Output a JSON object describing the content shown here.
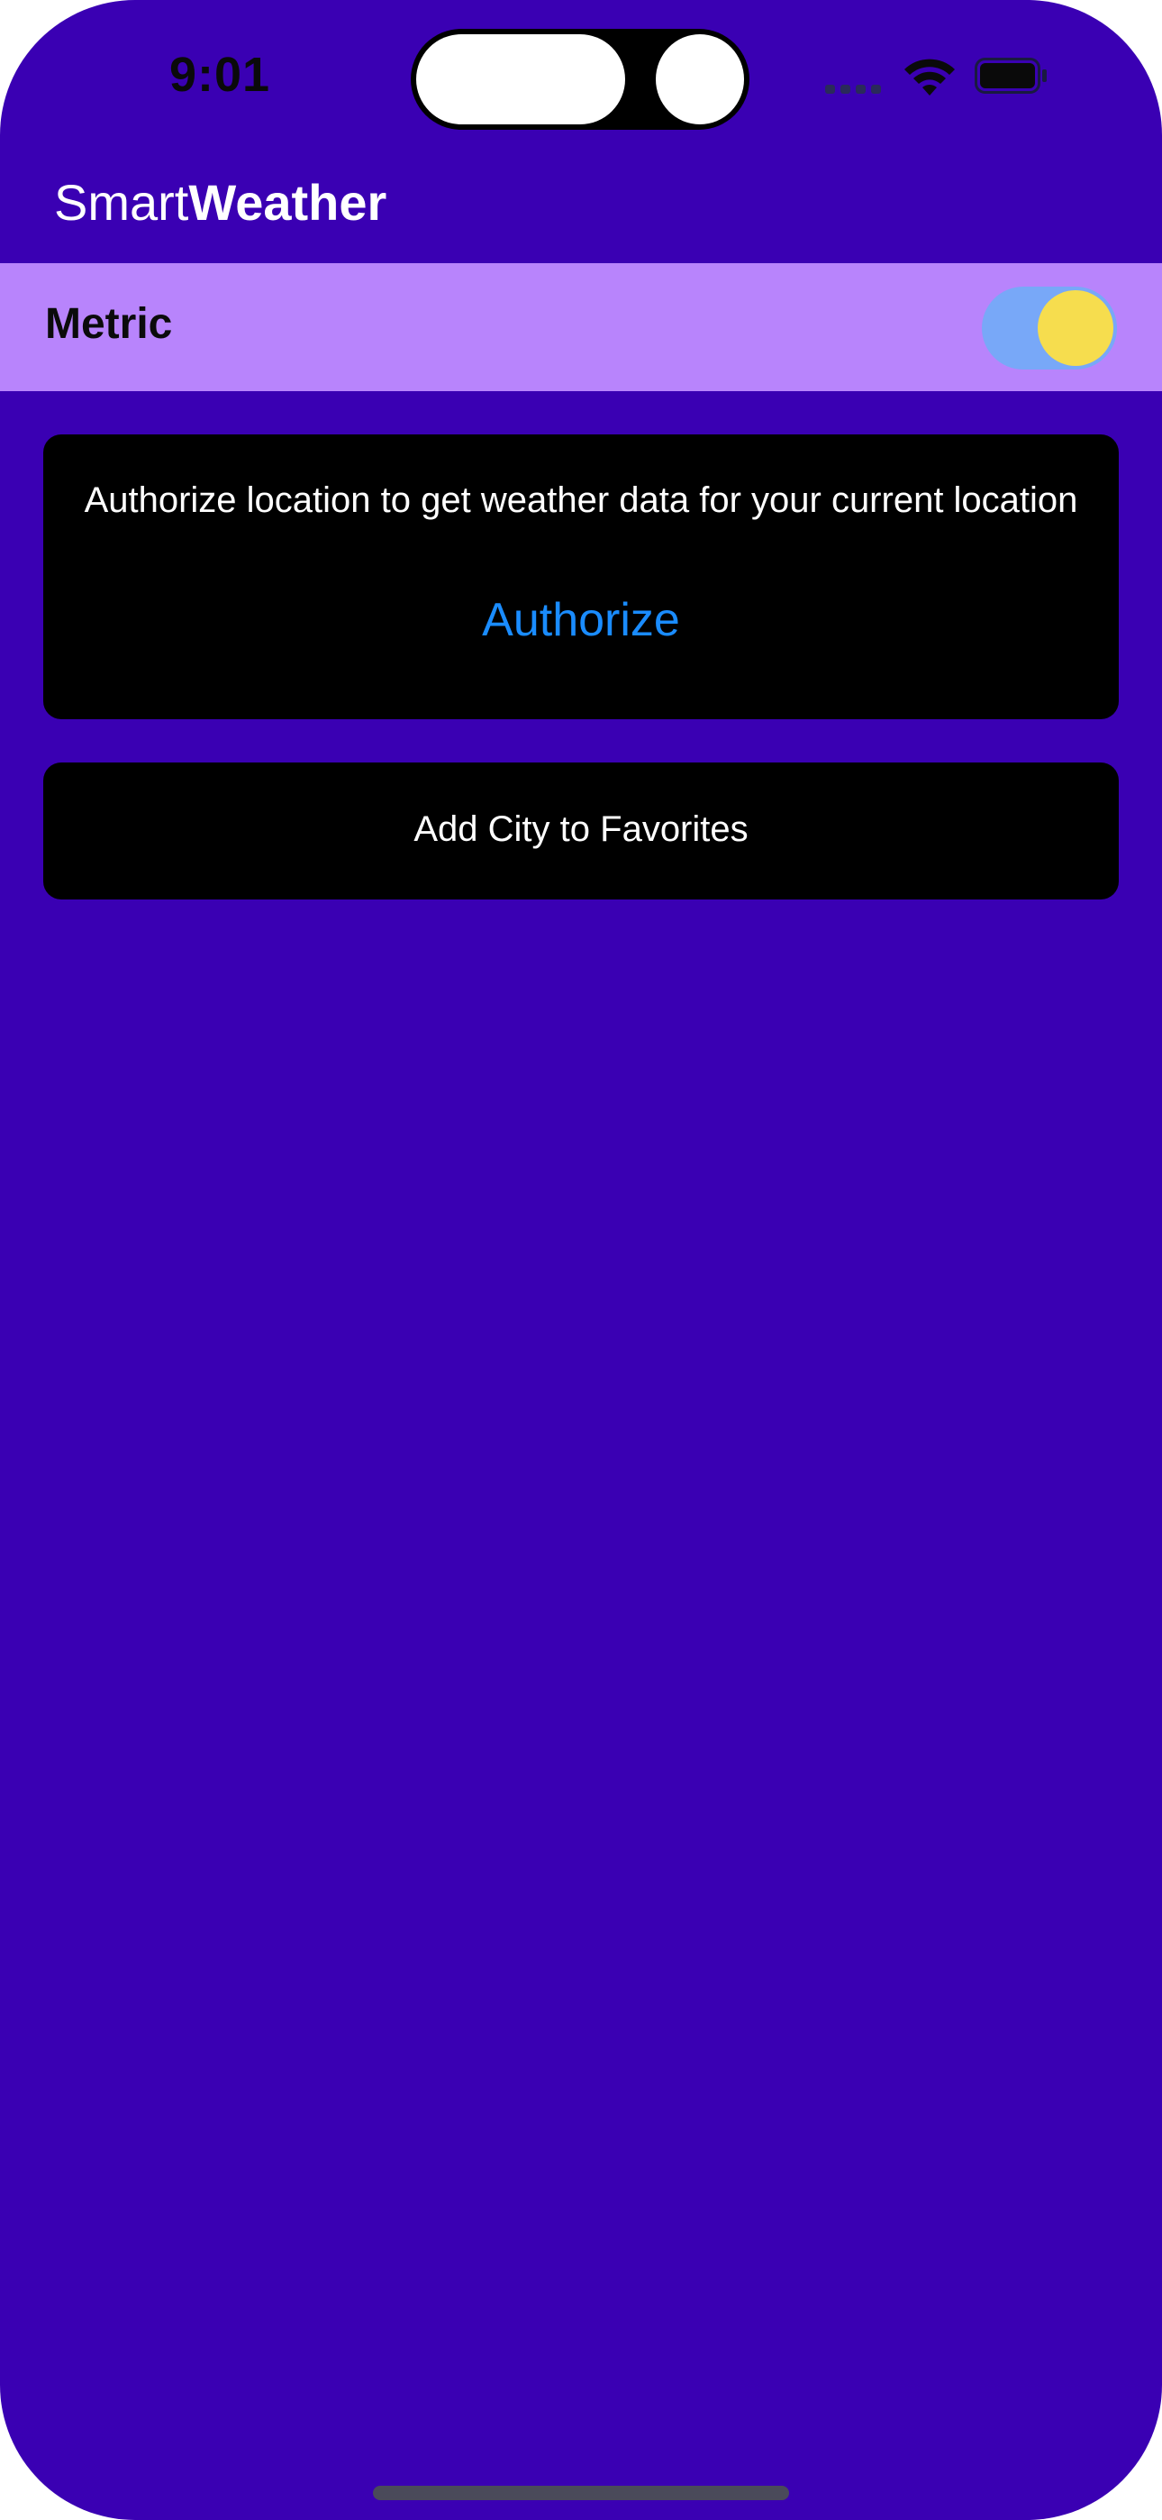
{
  "status_bar": {
    "time": "9:01",
    "icons": [
      "cellular-signal-icon",
      "wifi-icon",
      "battery-icon"
    ]
  },
  "header": {
    "title_light": "Smart",
    "title_bold": "Weather"
  },
  "units": {
    "label": "Metric",
    "toggle_on": true
  },
  "location_card": {
    "message": "Authorize location to get weather data for your current location",
    "action_label": "Authorize"
  },
  "favorites": {
    "add_label": "Add City to Favorites"
  },
  "colors": {
    "background": "#3a00b3",
    "metric_bar": "#b884fc",
    "card": "#000000",
    "link": "#1a8cff",
    "toggle_track": "#78a8f8",
    "toggle_knob": "#f6dd4e"
  }
}
